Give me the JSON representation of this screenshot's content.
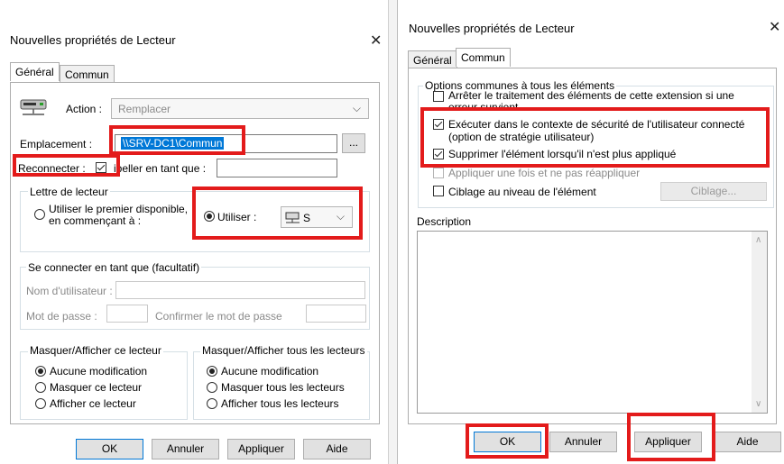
{
  "left": {
    "title": "Nouvelles propriétés de Lecteur",
    "close": "✕",
    "tabs": [
      "Général",
      "Commun"
    ],
    "action_label": "Action :",
    "action_value": "Remplacer",
    "emplacement_label": "Emplacement :",
    "emplacement_value": "\\\\SRV-DC1\\Commun",
    "browse_label": "...",
    "reconnect_label": "Reconnecter :",
    "libeller_label": "ibeller en tant que :",
    "lettre_group": "Lettre de lecteur",
    "first_available_1": "Utiliser le premier disponible,",
    "first_available_2": "en commençant à :",
    "utiliser_label": "Utiliser :",
    "drive_letter": "S",
    "connect_group": "Se connecter en tant que (facultatif)",
    "username_label": "Nom d'utilisateur :",
    "password_label": "Mot de passe :",
    "confirm_label": "Confirmer le mot de passe",
    "hide_group": "Masquer/Afficher ce lecteur",
    "hide_opts": [
      "Aucune modification",
      "Masquer ce lecteur",
      "Afficher ce lecteur"
    ],
    "hideall_group": "Masquer/Afficher tous les lecteurs",
    "hideall_opts": [
      "Aucune modification",
      "Masquer tous les lecteurs",
      "Afficher tous les lecteurs"
    ],
    "buttons": [
      "OK",
      "Annuler",
      "Appliquer",
      "Aide"
    ]
  },
  "right": {
    "title": "Nouvelles propriétés de Lecteur",
    "close": "✕",
    "tabs": [
      "Général",
      "Commun"
    ],
    "options_group": "Options communes à tous les éléments",
    "opt1_line1": "Arrêter le traitement des éléments de cette extension si une",
    "opt1_line2": "erreur survient",
    "opt2_line1": "Exécuter dans le contexte de sécurité de l'utilisateur connecté",
    "opt2_line2": "(option de stratégie utilisateur)",
    "opt3": "Supprimer l'élément lorsqu'il n'est plus appliqué",
    "opt4": "Appliquer une fois et ne pas réappliquer",
    "opt5": "Ciblage au niveau de l'élément",
    "ciblage_button": "Ciblage...",
    "description_label": "Description",
    "buttons": [
      "OK",
      "Annuler",
      "Appliquer",
      "Aide"
    ]
  },
  "colors": {
    "highlight": "#e31b1b",
    "selection": "#0078d7"
  }
}
